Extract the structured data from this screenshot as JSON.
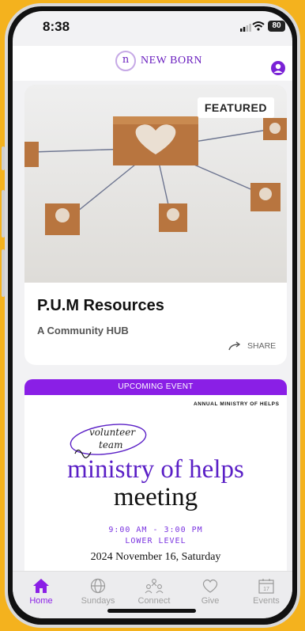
{
  "status_bar": {
    "time": "8:38",
    "battery": "80"
  },
  "app_bar": {
    "logo_letter": "n",
    "title": "NEW BORN"
  },
  "featured_card": {
    "badge": "FEATURED",
    "title": "P.U.M Resources",
    "subtitle": "A Community HUB",
    "share_label": "SHARE"
  },
  "event_card": {
    "banner": "UPCOMING EVENT",
    "flyer": {
      "header": "ANNUAL MINISTRY OF HELPS",
      "script_line1": "volunteer",
      "script_line2": "team",
      "title_line1": "ministry of helps",
      "title_line2": "meeting",
      "time": "9:00 AM - 3:00 PM",
      "location": "LOWER LEVEL",
      "date": "2024 November 16, Saturday"
    }
  },
  "tabs": [
    {
      "label": "Home",
      "icon": "home-icon",
      "active": true
    },
    {
      "label": "Sundays",
      "icon": "globe-icon",
      "active": false
    },
    {
      "label": "Connect",
      "icon": "people-icon",
      "active": false
    },
    {
      "label": "Give",
      "icon": "heart-icon",
      "active": false
    },
    {
      "label": "Events",
      "icon": "calendar-icon",
      "active": false
    }
  ],
  "colors": {
    "accent": "#8a1fe6",
    "background": "#f4b21e"
  }
}
